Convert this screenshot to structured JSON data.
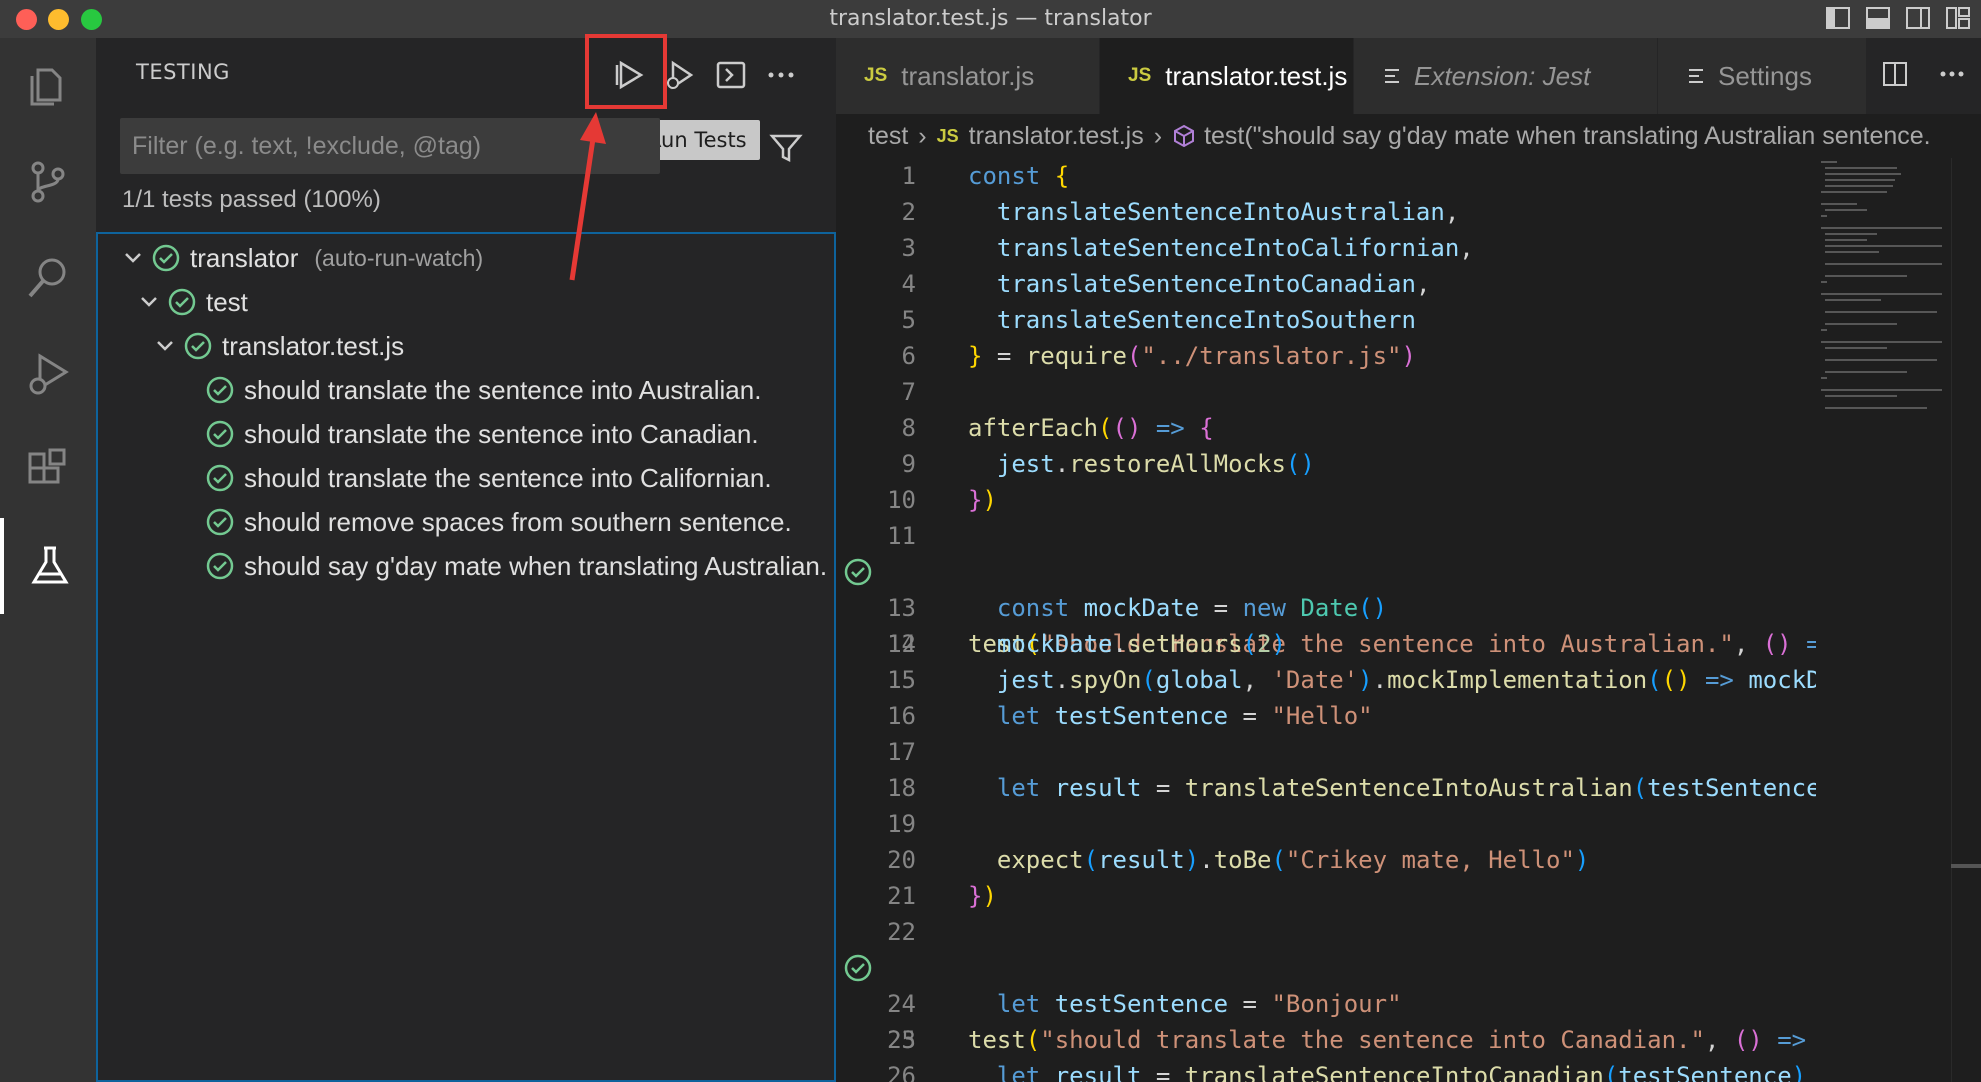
{
  "window": {
    "title": "translator.test.js — translator"
  },
  "sidebar": {
    "title": "TESTING",
    "tooltip": "Run Tests",
    "filter_placeholder": "Filter (e.g. text, !exclude, @tag)",
    "summary": "1/1 tests passed (100%)",
    "tree": {
      "root": {
        "label": "translator",
        "description": "(auto-run-watch)"
      },
      "folder": "test",
      "file": "translator.test.js",
      "tests": [
        "should translate the sentence into Australian.",
        "should translate the sentence into Canadian.",
        "should translate the sentence into Californian.",
        "should remove spaces from southern sentence.",
        "should say g'day mate when translating Australian."
      ]
    }
  },
  "editor": {
    "tabs": [
      {
        "label": "translator.js",
        "icon": "JS"
      },
      {
        "label": "translator.test.js",
        "icon": "JS"
      },
      {
        "label": "Extension: Jest"
      },
      {
        "label": "Settings"
      }
    ],
    "breadcrumb": {
      "folder": "test",
      "file": "translator.test.js",
      "symbol": "test(\"should say g'day mate when translating Australian sentence."
    }
  },
  "colors": {
    "pass": "#73c991",
    "highlight": "#e53935",
    "accent": "#0e639c"
  }
}
